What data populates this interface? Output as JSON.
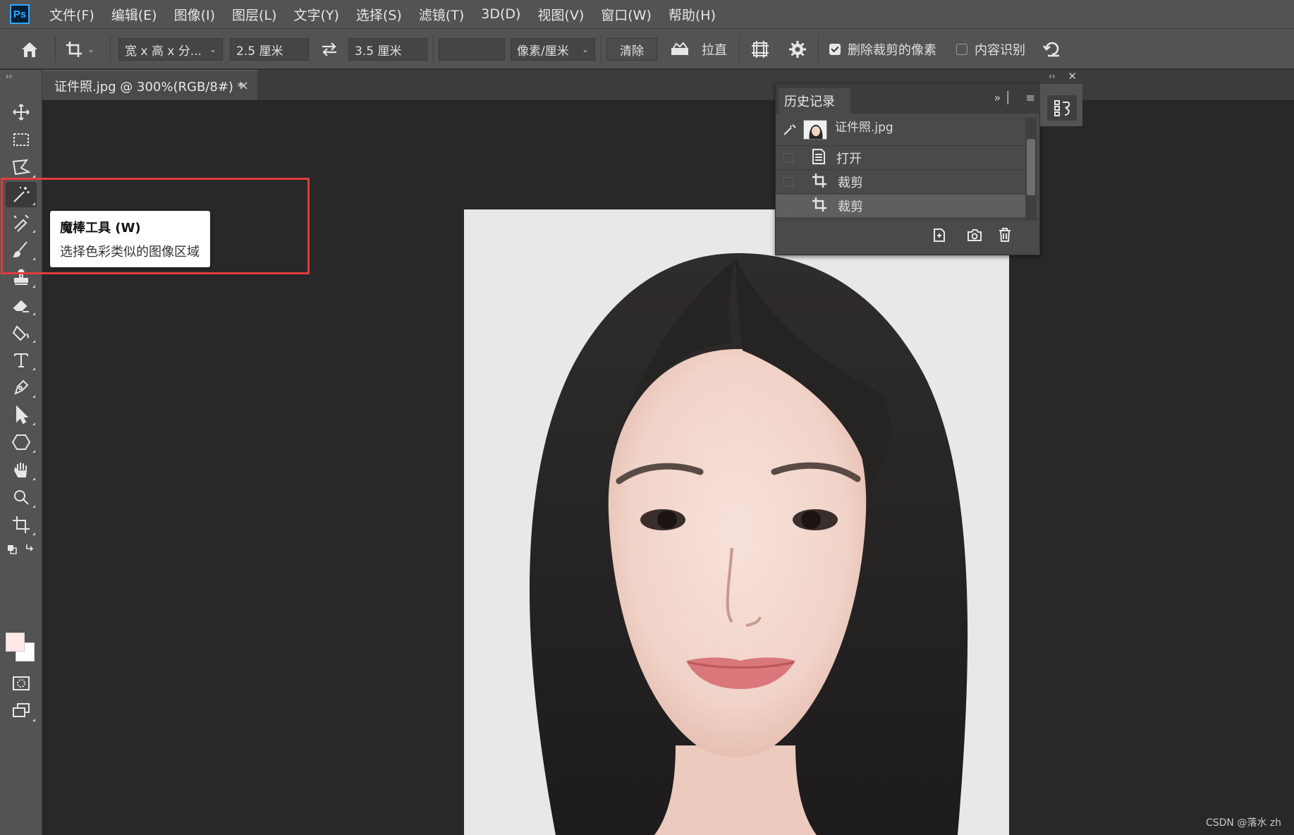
{
  "app": {
    "logo_text": "Ps"
  },
  "menu": [
    "文件(F)",
    "编辑(E)",
    "图像(I)",
    "图层(L)",
    "文字(Y)",
    "选择(S)",
    "滤镜(T)",
    "3D(D)",
    "视图(V)",
    "窗口(W)",
    "帮助(H)"
  ],
  "options": {
    "ratio_select": "宽 x 高 x 分...",
    "width_value": "2.5 厘米",
    "height_value": "3.5 厘米",
    "resolution_value": "",
    "unit_select": "像素/厘米",
    "clear_label": "清除",
    "straighten_label": "拉直",
    "delete_cropped_label": "删除裁剪的像素",
    "delete_cropped_checked": true,
    "content_aware_label": "内容识别",
    "content_aware_checked": false
  },
  "document_tab": {
    "title": "证件照.jpg @ 300%(RGB/8#) *",
    "close": "×"
  },
  "toolbar": {
    "tools": [
      "move-tool",
      "rectangular-marquee-tool",
      "polygonal-lasso-tool",
      "magic-wand-tool",
      "spot-healing-tool",
      "brush-tool",
      "clone-stamp-tool",
      "eraser-tool",
      "paint-bucket-tool",
      "type-tool",
      "pen-tool",
      "path-selection-tool",
      "shape-tool",
      "hand-tool",
      "zoom-tool",
      "crop-tool"
    ],
    "active_tool": "magic-wand-tool",
    "foreground_color": "#fce9e8",
    "background_color": "#ffffff"
  },
  "tooltip": {
    "title": "魔棒工具 (W)",
    "description": "选择色彩类似的图像区域"
  },
  "history_panel": {
    "tab": "历史记录",
    "snapshot_label": "证件照.jpg",
    "items": [
      {
        "label": "打开",
        "icon": "document-icon",
        "current": false
      },
      {
        "label": "裁剪",
        "icon": "crop-icon",
        "current": false
      },
      {
        "label": "裁剪",
        "icon": "crop-icon",
        "current": true
      }
    ]
  },
  "colors": {
    "highlight_border": "#e23b3b",
    "ps_blue": "#31a8ff"
  },
  "watermark": "CSDN @落水 zh"
}
